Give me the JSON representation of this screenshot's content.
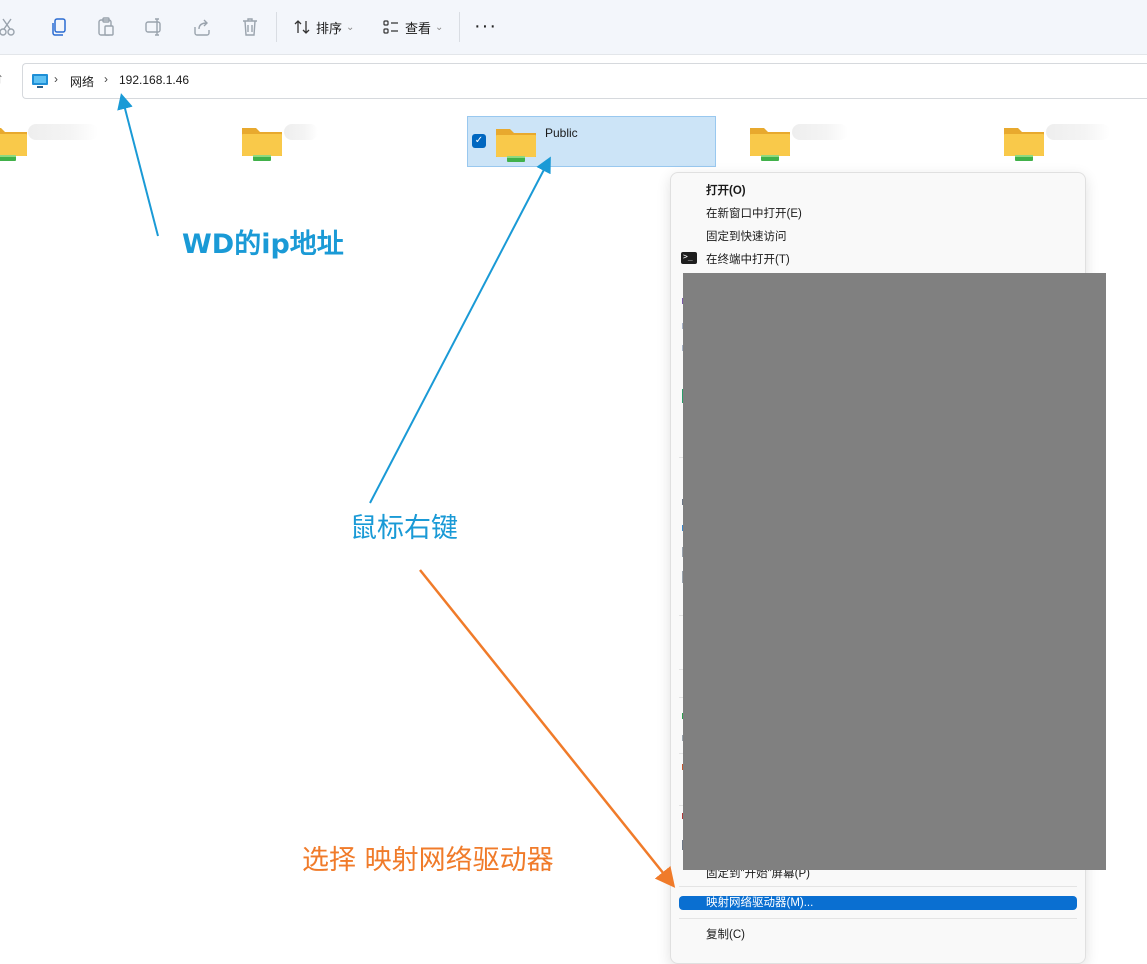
{
  "toolbar": {
    "icons": [
      "cut-icon",
      "copy-icon",
      "paste-icon",
      "rename-icon",
      "share-icon",
      "delete-icon"
    ],
    "sort_label": "排序",
    "view_label": "查看",
    "more_label": "···"
  },
  "address": {
    "root_icon": "computer-icon",
    "crumbs": [
      "网络",
      "192.168.1.46"
    ]
  },
  "folders": {
    "selected_label": "Public"
  },
  "context_menu": {
    "open": "打开(O)",
    "open_new_window": "在新窗口中打开(E)",
    "pin_quick_access": "固定到快速访问",
    "open_in_terminal": "在终端中打开(T)",
    "pin_start": "固定到\"开始\"屏幕(P)",
    "map_drive": "映射网络驱动器(M)...",
    "copy": "复制(C)"
  },
  "annotations": {
    "ip_note": "WD的ip地址",
    "right_click_note": "鼠标右键",
    "map_note": "选择 映射网络驱动器"
  },
  "colors": {
    "accent": "#0067c0",
    "annotation_blue": "#1a9ad6",
    "annotation_orange": "#f07b2a",
    "folder_yellow": "#f9c94a",
    "redaction_gray": "#808080"
  }
}
